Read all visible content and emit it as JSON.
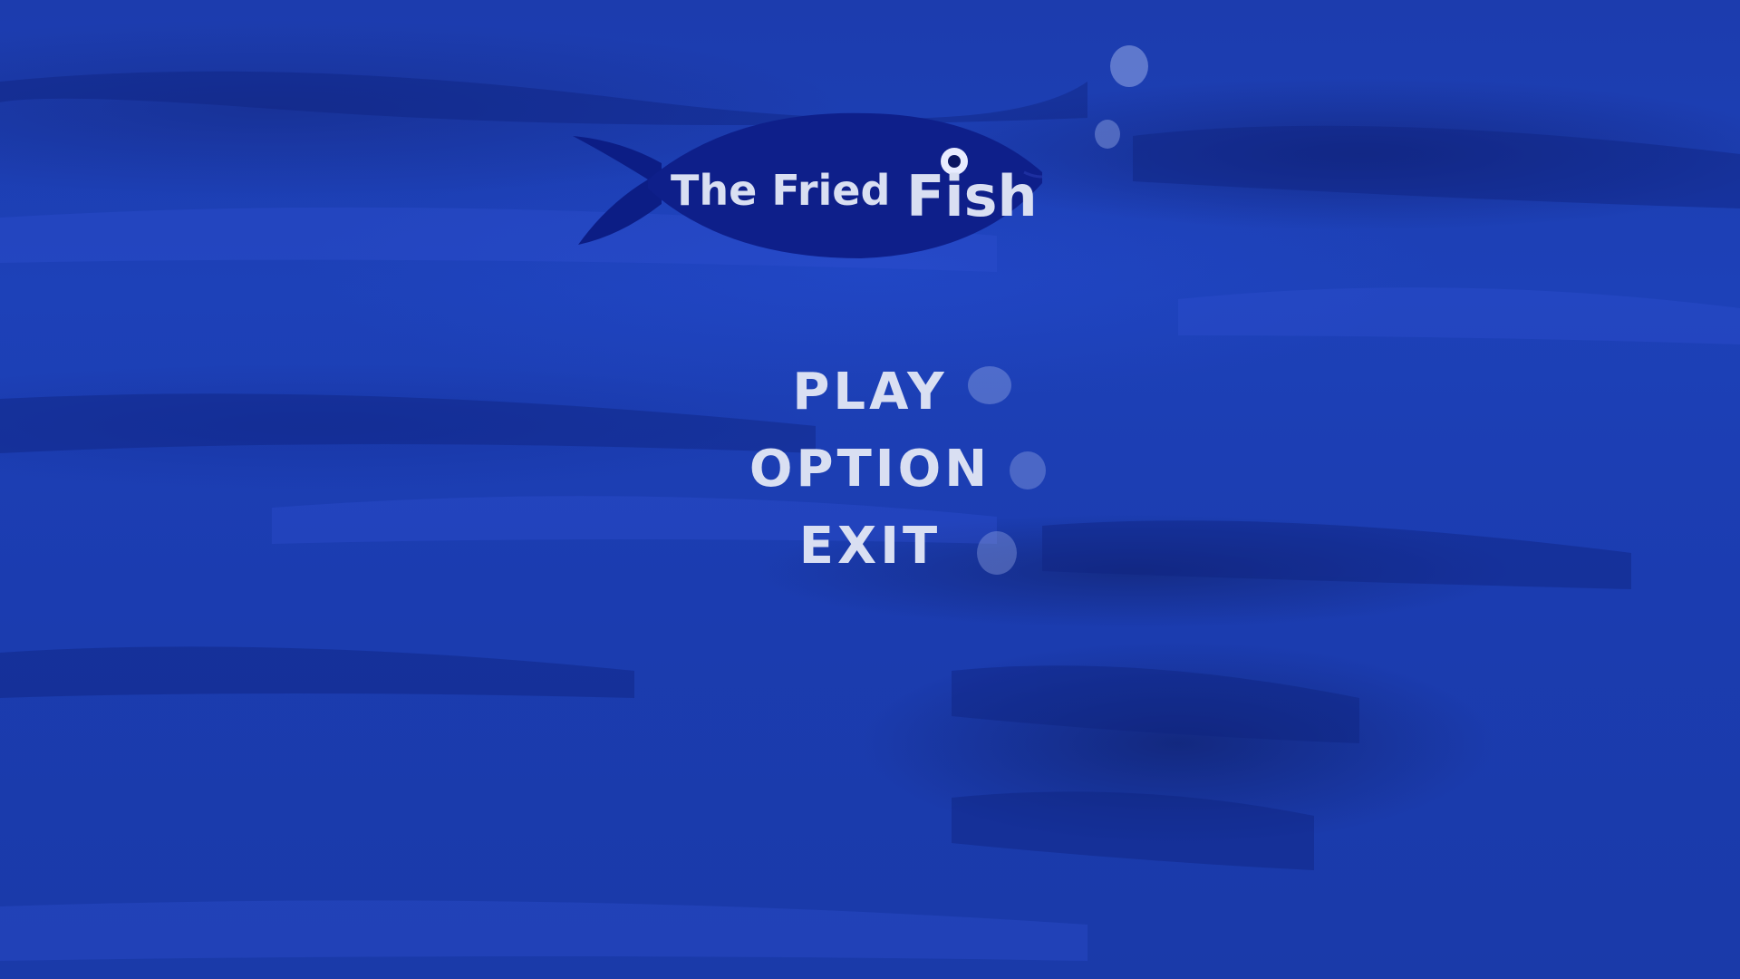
{
  "game": {
    "title_line1": "The Fried",
    "title_line2": "Fish"
  },
  "menu": {
    "items": [
      {
        "label": "PLAY"
      },
      {
        "label": "OPTION"
      },
      {
        "label": "EXIT"
      }
    ]
  },
  "colors": {
    "background": "#1b3cb0",
    "fish": "#0e1f8a",
    "text": "#d9dff2",
    "bubble": "#96aae6"
  }
}
